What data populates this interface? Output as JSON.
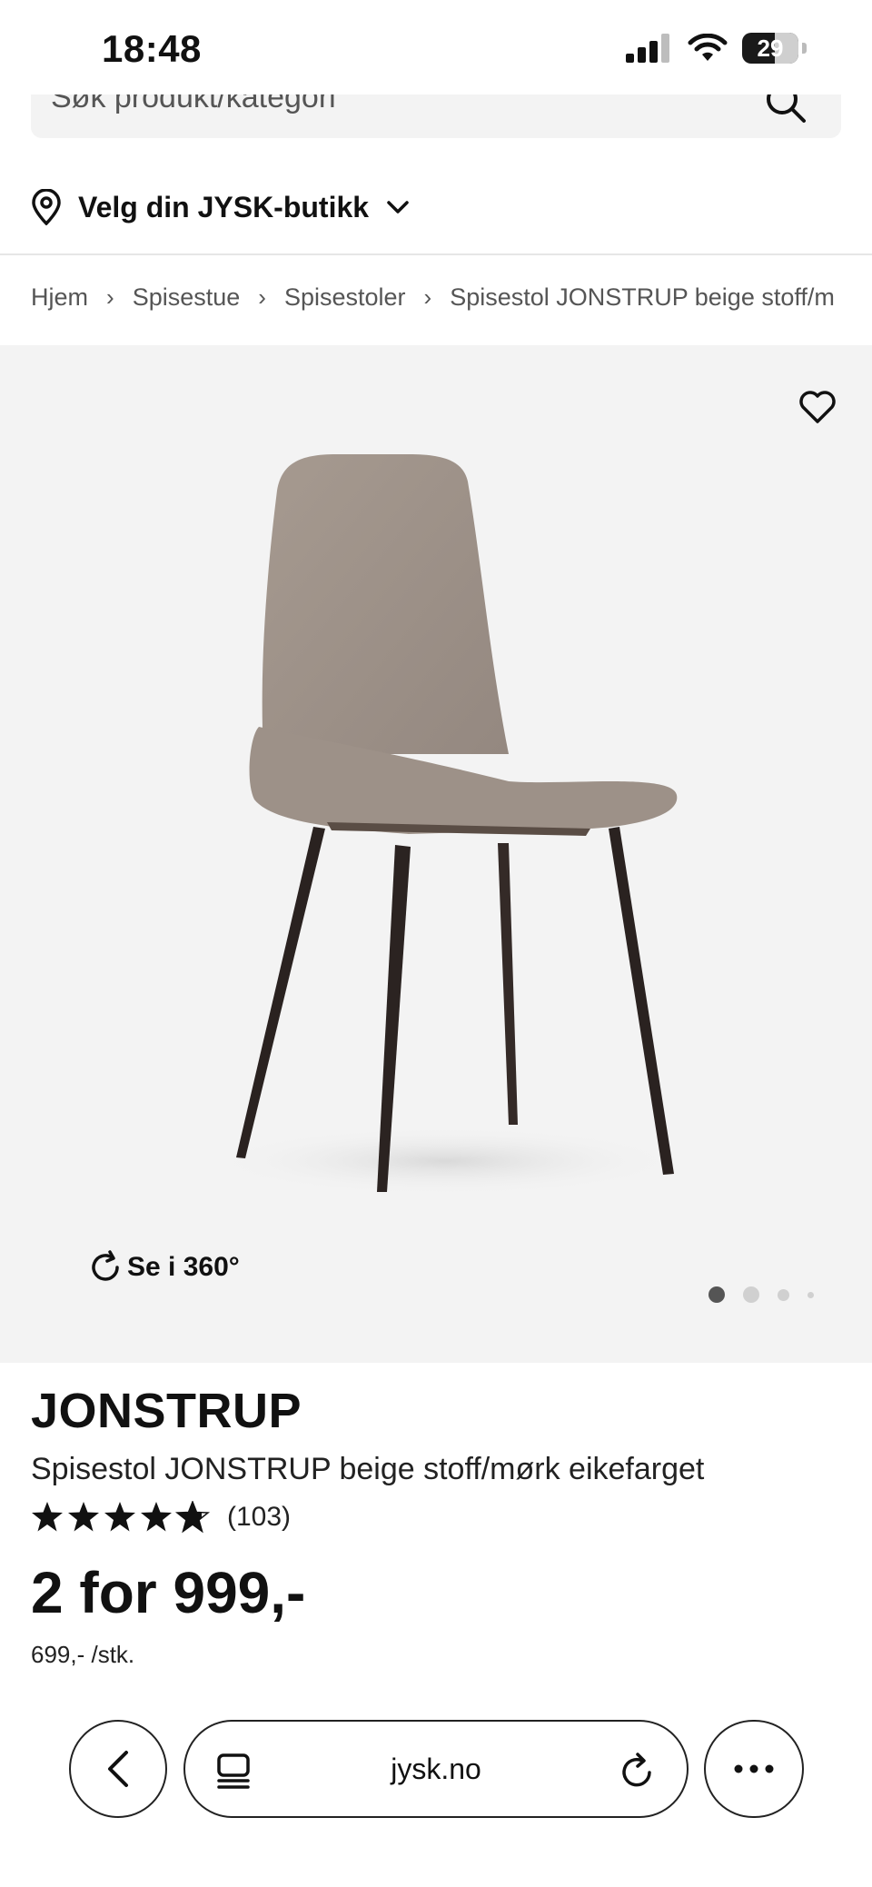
{
  "status": {
    "time": "18:48",
    "battery": "29"
  },
  "search": {
    "placeholder": "Søk produkt/kategori"
  },
  "store": {
    "label": "Velg din JYSK-butikk"
  },
  "breadcrumb": [
    "Hjem",
    "Spisestue",
    "Spisestoler",
    "Spisestol JONSTRUP beige stoff/m"
  ],
  "gallery": {
    "see360": "Se i 360°",
    "image_count": 4,
    "active_index": 0
  },
  "product": {
    "brand": "JONSTRUP",
    "name": "Spisestol JONSTRUP beige stoff/mørk eikefarget",
    "rating": 4.8,
    "rating_count": "(103)",
    "price": "2 for 999,-",
    "unit_price": "699,- /stk."
  },
  "browser": {
    "url": "jysk.no"
  },
  "icons": {
    "signal": "signal-icon",
    "wifi": "wifi-icon",
    "battery": "battery-icon",
    "search": "search-icon",
    "location": "location-pin-icon",
    "chevron": "chevron-down-icon",
    "heart": "heart-icon",
    "rotate": "rotate-360-icon",
    "back": "back-arrow-icon",
    "tabs": "tabs-icon",
    "reload": "reload-icon",
    "more": "more-icon"
  },
  "colors": {
    "gallery_bg": "#f3f3f3",
    "text": "#111111"
  }
}
